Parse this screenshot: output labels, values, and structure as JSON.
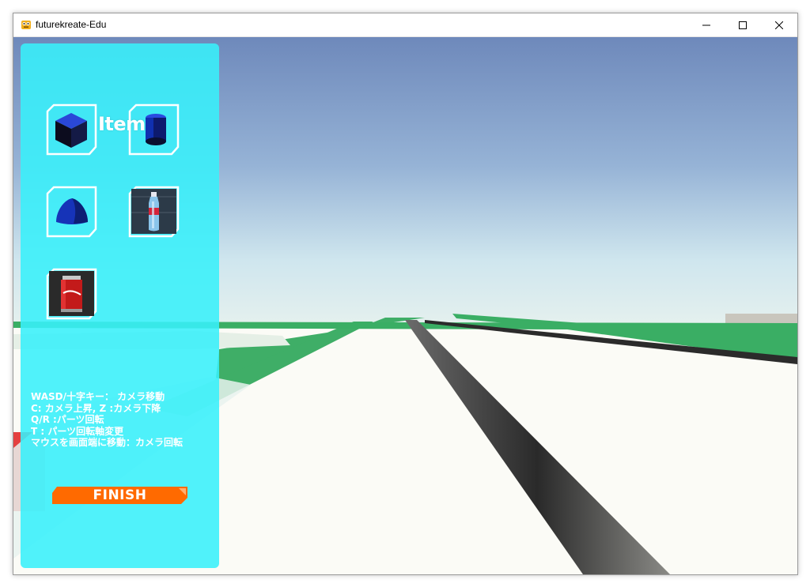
{
  "window": {
    "title": "futurekreate-Edu",
    "controls": [
      "minimize-icon",
      "maximize-icon",
      "close-icon"
    ]
  },
  "panel": {
    "title": "Items",
    "items": [
      {
        "name": "cube",
        "icon": "blue-cube-icon"
      },
      {
        "name": "cylinder",
        "icon": "blue-cylinder-icon"
      },
      {
        "name": "dome",
        "icon": "blue-dome-icon"
      },
      {
        "name": "bottle",
        "icon": "plastic-bottle-icon"
      },
      {
        "name": "can",
        "icon": "soda-can-icon"
      }
    ],
    "help_lines": [
      "WASD/十字キー： カメラ移動",
      "C: カメラ上昇, Z :カメラ下降",
      "Q/R :パーツ回転",
      "T : パーツ回転軸変更",
      "マウスを画面端に移動：カメラ回転"
    ],
    "finish_label": "FINISH"
  },
  "colors": {
    "panel": "#38f0fa",
    "finish": "#ff6a00",
    "sky_top": "#6f8bbd",
    "grass": "#3aae64"
  }
}
